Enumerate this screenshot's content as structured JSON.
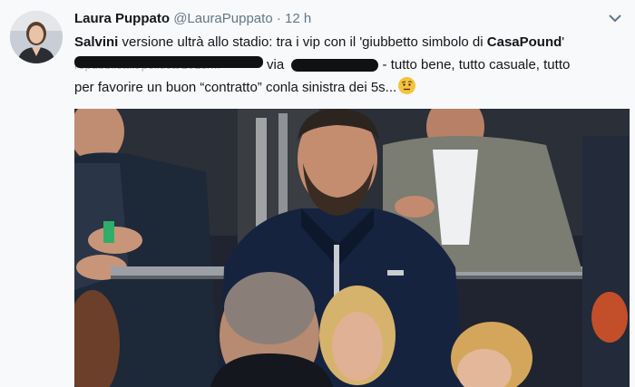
{
  "tweet": {
    "author_name": "Laura Puppato",
    "author_handle": "@LauraPuppato",
    "separator": "·",
    "timestamp": "12 h",
    "line1_bold_start": "Salvini",
    "line1_middle": " versione ultrà allo stadio: tra i vip con il 'giubbetto simbolo di ",
    "line1_bold_end": "CasaPound",
    "line1_end": "'",
    "line2_faded": "repubblica.it/politica/2018/...",
    "line2_via": "via",
    "line2_after": "- tutto bene, tutto casuale, tutto",
    "line3": "per favorire un buon “contratto” conla sinistra dei 5s...",
    "colors": {
      "text": "#14171a",
      "muted": "#657786",
      "background": "#f7f9fb"
    }
  }
}
